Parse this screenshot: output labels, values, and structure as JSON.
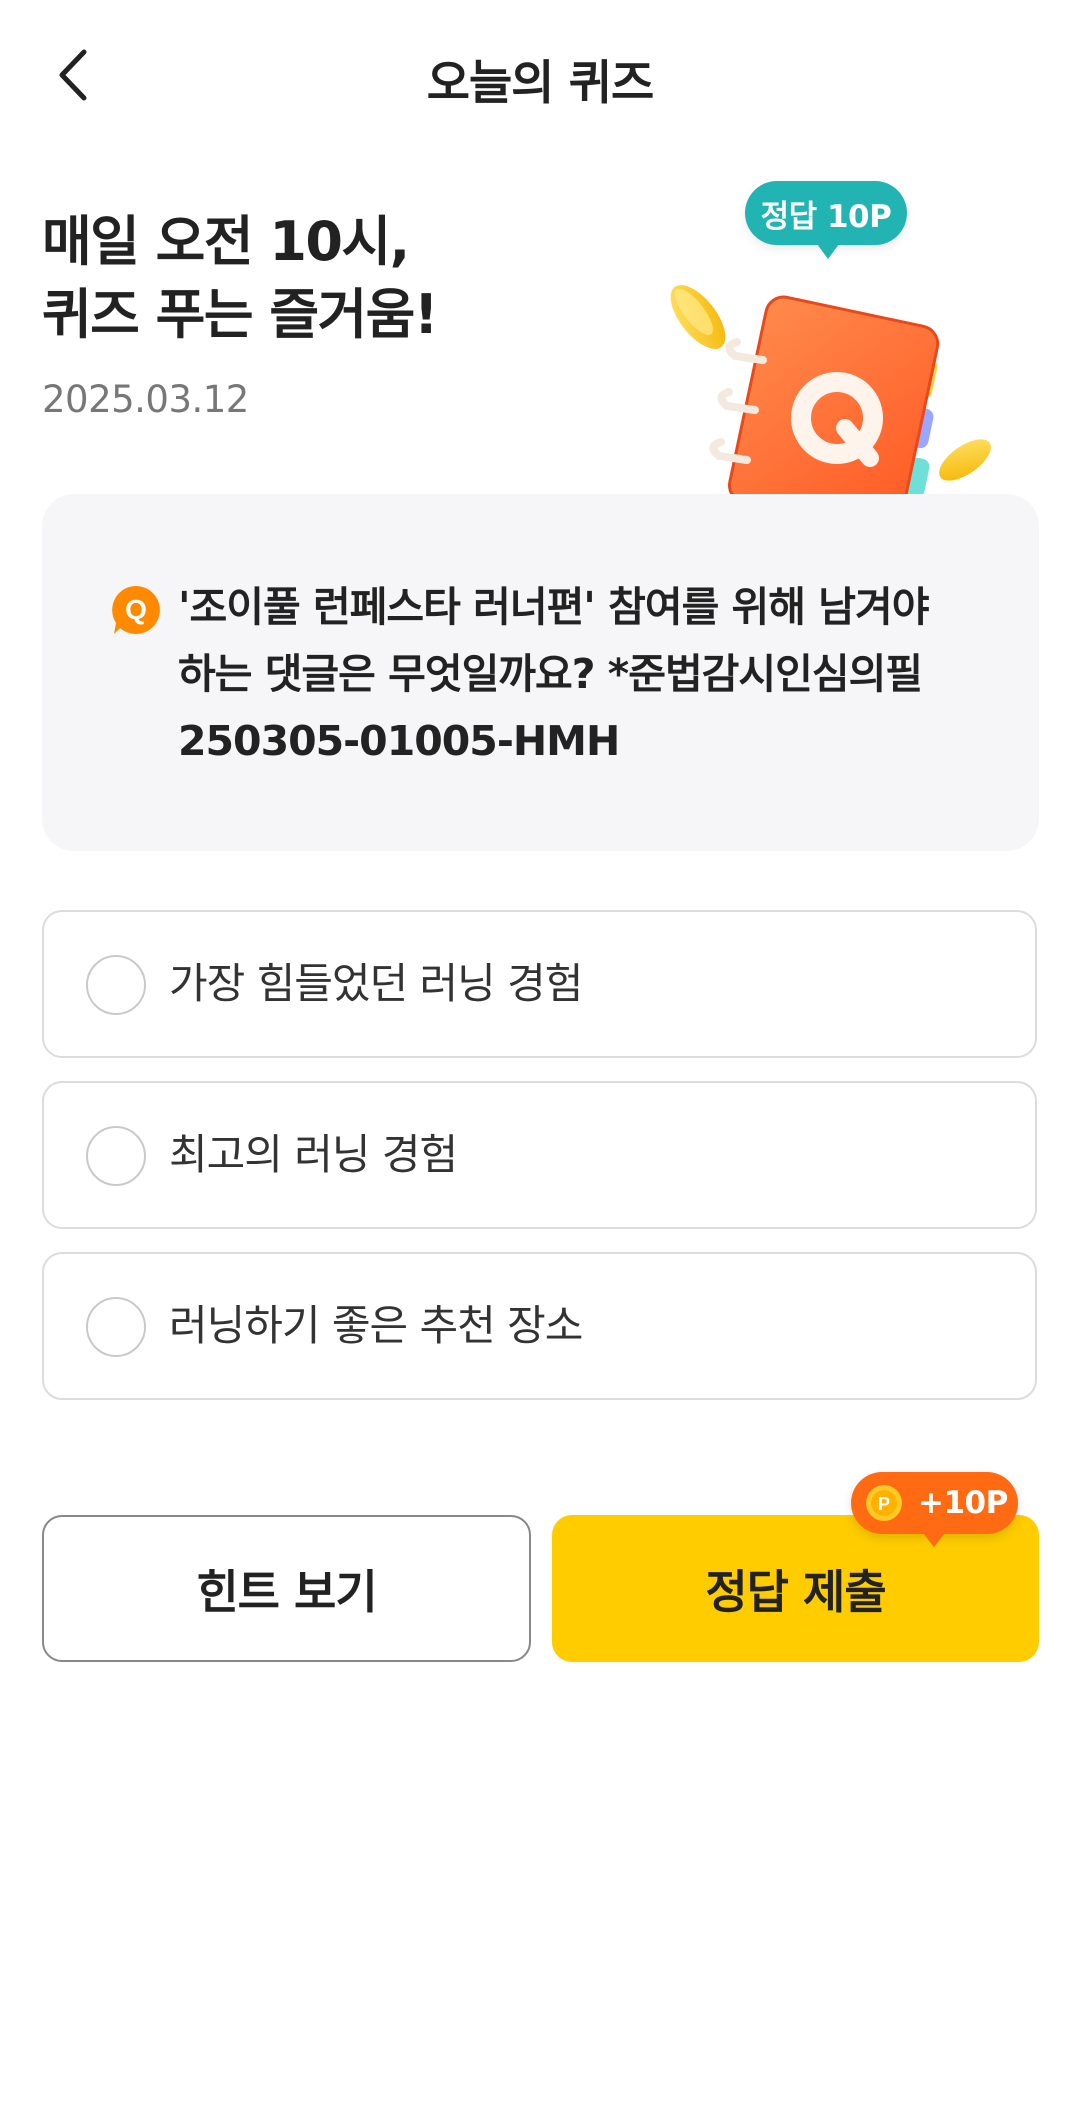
{
  "header": {
    "title": "오늘의 퀴즈",
    "back_icon": "chevron-left-icon"
  },
  "hero": {
    "title_lines": [
      "매일 오전 10시,",
      "퀴즈 푸는 즐거움!"
    ],
    "date": "2025.03.12",
    "reward_badge": "정답 10P",
    "illustration_icon": "quiz-notebook-icon"
  },
  "question": {
    "icon": "q-icon",
    "icon_letter": "Q",
    "lines": [
      "'조이풀 런페스타 러너편' 참여를 위해 남겨야",
      "하는 댓글은 무엇일까요? *준법감시인심의필",
      "250305-01005-HMH"
    ]
  },
  "options": [
    {
      "label": "가장 힘들었던 러닝 경험",
      "selected": false
    },
    {
      "label": "최고의 러닝 경험",
      "selected": false
    },
    {
      "label": "러닝하기 좋은 추천 장소",
      "selected": false
    }
  ],
  "actions": {
    "hint_label": "힌트 보기",
    "submit_label": "정답 제출",
    "point_badge": "+10P",
    "coin_letter": "P"
  },
  "colors": {
    "accent_yellow": "#ffcc00",
    "teal_badge": "#22b3b3",
    "orange_badge": "#ff6a13",
    "q_icon": "#ff8a00",
    "card_bg": "#f6f6f8"
  }
}
